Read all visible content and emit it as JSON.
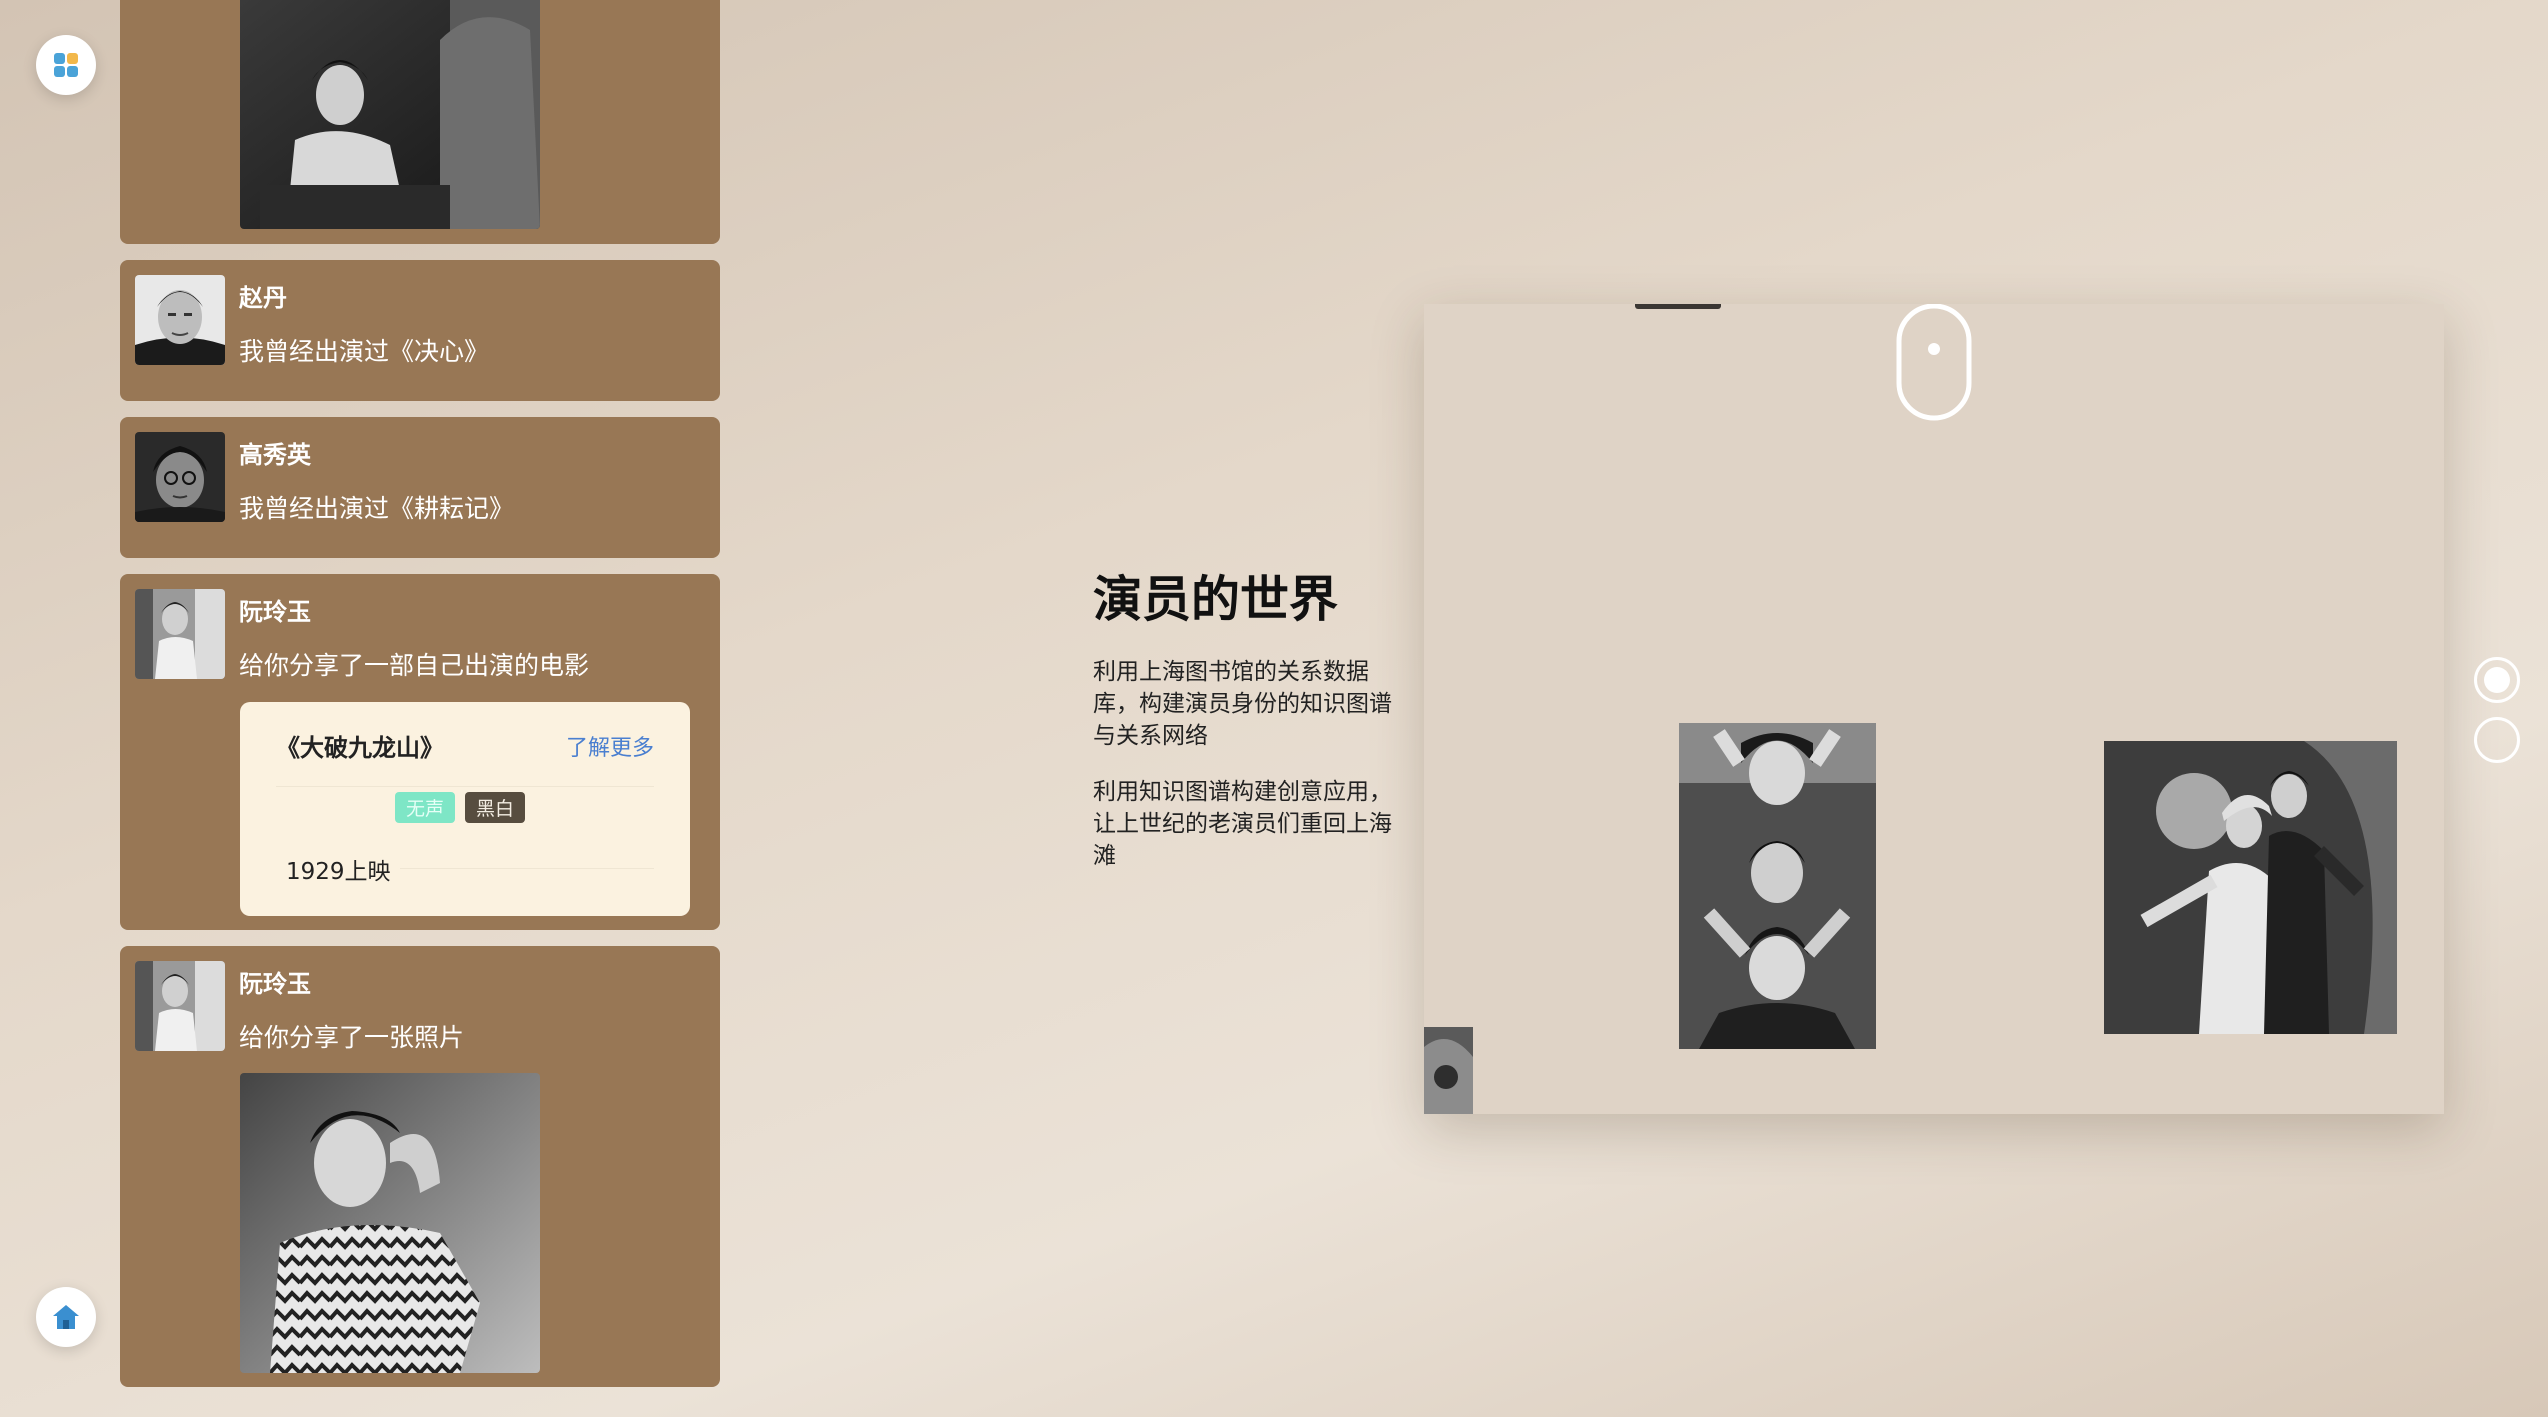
{
  "colors": {
    "card": "#987755",
    "movie_card": "#fbf2e0",
    "tag_silent": "#7ee6c6",
    "tag_bw": "#574d3f",
    "link": "#4a7fd0"
  },
  "icons": {
    "apps": "apps-grid-icon",
    "home": "home-icon",
    "scroll": "mouse-scroll-icon"
  },
  "feed": [
    {
      "name": "赵丹",
      "message": "我曾经出演过《决心》"
    },
    {
      "name": "高秀英",
      "message": "我曾经出演过《耕耘记》"
    },
    {
      "name": "阮玲玉",
      "message": "给你分享了一部自己出演的电影",
      "movie": {
        "title": "《大破九龙山》",
        "more": "了解更多",
        "tags": [
          "无声",
          "黑白"
        ],
        "release": "1929上映"
      }
    },
    {
      "name": "阮玲玉",
      "message": "给你分享了一张照片"
    }
  ],
  "hero": {
    "title": "演员的世界",
    "paragraphs": [
      "利用上海图书馆的关系数据库，构建演员身份的知识图谱与关系网络",
      "利用知识图谱构建创意应用，让上世纪的老演员们重回上海滩"
    ]
  },
  "pager": {
    "total": 2,
    "active": 1
  }
}
